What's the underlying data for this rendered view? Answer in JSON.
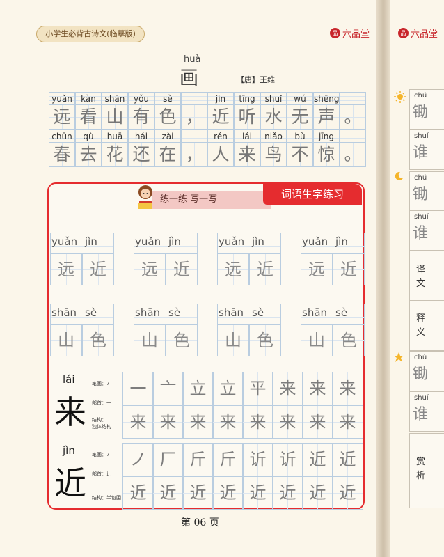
{
  "header": {
    "series": "小学生必背古诗文(临摹版)",
    "brand_seal": "品",
    "brand": "六品堂"
  },
  "poem": {
    "title_pinyin": "huà",
    "title": "画",
    "author": "【唐】王维",
    "lines": [
      [
        {
          "py": "yuǎn",
          "hz": "远"
        },
        {
          "py": "kàn",
          "hz": "看"
        },
        {
          "py": "shān",
          "hz": "山"
        },
        {
          "py": "yǒu",
          "hz": "有"
        },
        {
          "py": "sè",
          "hz": "色"
        },
        {
          "py": "",
          "hz": "，"
        },
        {
          "py": "jìn",
          "hz": "近"
        },
        {
          "py": "tīng",
          "hz": "听"
        },
        {
          "py": "shuǐ",
          "hz": "水"
        },
        {
          "py": "wú",
          "hz": "无"
        },
        {
          "py": "shēng",
          "hz": "声"
        },
        {
          "py": "",
          "hz": "。"
        }
      ],
      [
        {
          "py": "chūn",
          "hz": "春"
        },
        {
          "py": "qù",
          "hz": "去"
        },
        {
          "py": "huā",
          "hz": "花"
        },
        {
          "py": "hái",
          "hz": "还"
        },
        {
          "py": "zài",
          "hz": "在"
        },
        {
          "py": "",
          "hz": "，"
        },
        {
          "py": "rén",
          "hz": "人"
        },
        {
          "py": "lái",
          "hz": "来"
        },
        {
          "py": "niǎo",
          "hz": "鸟"
        },
        {
          "py": "bù",
          "hz": "不"
        },
        {
          "py": "jīng",
          "hz": "惊"
        },
        {
          "py": "",
          "hz": "。"
        }
      ]
    ]
  },
  "practice": {
    "banner": "练一练  写一写",
    "section_tag": "词语生字练习",
    "words": [
      {
        "py1": "yuǎn",
        "py2": "jìn",
        "c1": "远",
        "c2": "近"
      },
      {
        "py1": "shān",
        "py2": "sè",
        "c1": "山",
        "c2": "色"
      }
    ],
    "chars": [
      {
        "pinyin": "lái",
        "char": "来",
        "strokes": "笔画：7",
        "radical": "部首：一",
        "structure_label": "结构：",
        "structure": "独体结构",
        "trace_top": [
          "一",
          "亠",
          "立",
          "立",
          "平",
          "来",
          "来",
          "来"
        ],
        "trace_bottom": [
          "来",
          "来",
          "来",
          "来",
          "来",
          "来",
          "来",
          "来"
        ]
      },
      {
        "pinyin": "jìn",
        "char": "近",
        "strokes": "笔画：7",
        "radical": "部首：辶",
        "structure_label": "",
        "structure": "结构：半包围",
        "trace_top": [
          "ノ",
          "厂",
          "斤",
          "斤",
          "䜣",
          "䜣",
          "近",
          "近"
        ],
        "trace_bottom": [
          "近",
          "近",
          "近",
          "近",
          "近",
          "近",
          "近",
          "近"
        ]
      }
    ]
  },
  "footer": {
    "page": "第 06 页"
  },
  "next_page": {
    "brand": "六品堂",
    "rows": [
      {
        "py": "chú",
        "hz": "锄"
      },
      {
        "py": "shuí",
        "hz": "谁"
      },
      {
        "py": "chú",
        "hz": "锄"
      },
      {
        "py": "shuí",
        "hz": "谁"
      },
      {
        "py": "chú",
        "hz": "锄"
      },
      {
        "py": "shuí",
        "hz": "谁"
      }
    ],
    "label_translation": "译文",
    "label_meaning": "释义",
    "label_appreciation": "赏析"
  },
  "colors": {
    "accent_red": "#e52c2f",
    "grid_blue": "#b9cde0",
    "paper": "#fbf6ea"
  }
}
